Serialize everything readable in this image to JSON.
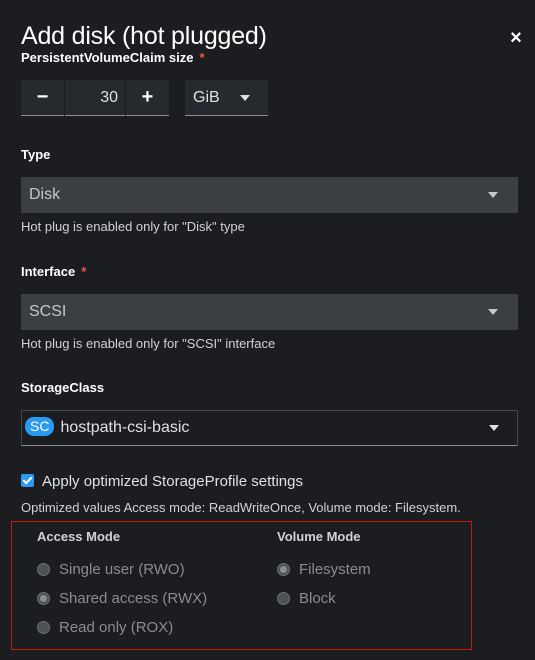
{
  "dialog": {
    "title": "Add disk (hot plugged)",
    "close_label": "×"
  },
  "size": {
    "label": "PersistentVolumeClaim size",
    "required_mark": "*",
    "decrement_label": "−",
    "increment_label": "+",
    "value": "30",
    "unit": "GiB"
  },
  "type": {
    "label": "Type",
    "value": "Disk",
    "helper": "Hot plug is enabled only for \"Disk\" type"
  },
  "interface": {
    "label": "Interface",
    "required_mark": "*",
    "value": "SCSI",
    "helper": "Hot plug is enabled only for \"SCSI\" interface"
  },
  "storage_class": {
    "label": "StorageClass",
    "badge": "SC",
    "value": "hostpath-csi-basic"
  },
  "optimized": {
    "checkbox_label": "Apply optimized StorageProfile settings",
    "checked": true,
    "helper": "Optimized values Access mode: ReadWriteOnce, Volume mode: Filesystem."
  },
  "access_mode": {
    "heading": "Access Mode",
    "options": [
      {
        "label": "Single user (RWO)",
        "checked": false
      },
      {
        "label": "Shared access (RWX)",
        "checked": true
      },
      {
        "label": "Read only (ROX)",
        "checked": false
      }
    ]
  },
  "volume_mode": {
    "heading": "Volume Mode",
    "options": [
      {
        "label": "Filesystem",
        "checked": true
      },
      {
        "label": "Block",
        "checked": false
      }
    ]
  },
  "colors": {
    "background": "#1b1d21",
    "accent": "#2b9af3",
    "required": "#f0564e",
    "highlight_border": "#c9190b"
  }
}
